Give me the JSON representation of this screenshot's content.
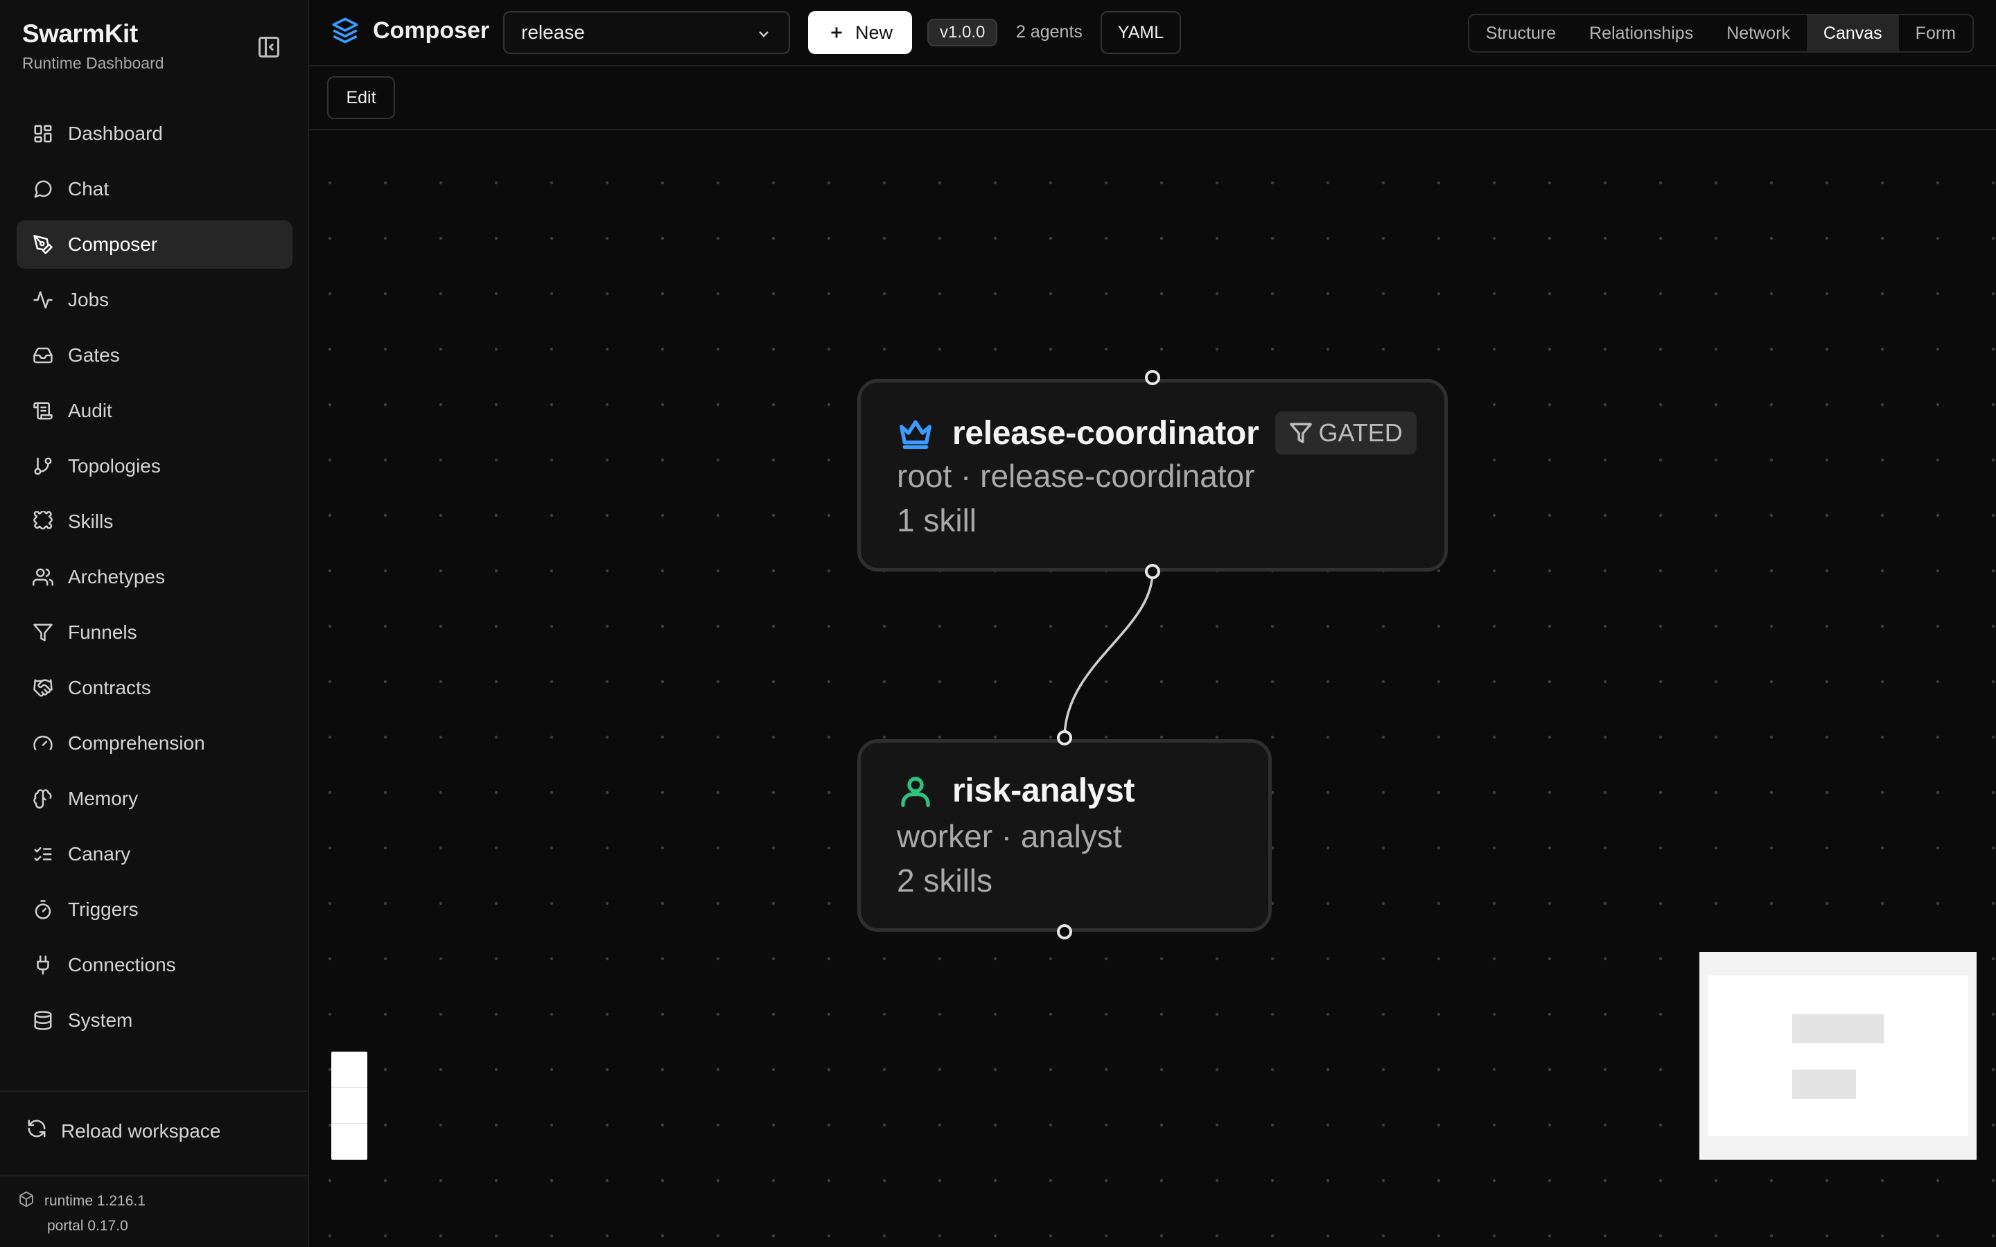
{
  "brand": {
    "title": "SwarmKit",
    "subtitle": "Runtime Dashboard"
  },
  "sidebar": {
    "items": [
      {
        "label": "Dashboard",
        "icon": "dashboard-icon"
      },
      {
        "label": "Chat",
        "icon": "chat-icon"
      },
      {
        "label": "Composer",
        "icon": "pen-tool-icon",
        "active": true
      },
      {
        "label": "Jobs",
        "icon": "activity-icon"
      },
      {
        "label": "Gates",
        "icon": "inbox-icon"
      },
      {
        "label": "Audit",
        "icon": "scroll-icon"
      },
      {
        "label": "Topologies",
        "icon": "git-branch-icon"
      },
      {
        "label": "Skills",
        "icon": "puzzle-icon"
      },
      {
        "label": "Archetypes",
        "icon": "users-icon"
      },
      {
        "label": "Funnels",
        "icon": "funnel-icon"
      },
      {
        "label": "Contracts",
        "icon": "handshake-icon"
      },
      {
        "label": "Comprehension",
        "icon": "gauge-icon"
      },
      {
        "label": "Memory",
        "icon": "brain-icon"
      },
      {
        "label": "Canary",
        "icon": "list-checks-icon"
      },
      {
        "label": "Triggers",
        "icon": "timer-icon"
      },
      {
        "label": "Connections",
        "icon": "plug-icon"
      },
      {
        "label": "System",
        "icon": "database-icon"
      }
    ],
    "reload_label": "Reload workspace",
    "runtime_version": "runtime 1.216.1",
    "portal_version": "portal 0.17.0"
  },
  "topbar": {
    "title": "Composer",
    "topology_select": "release",
    "new_label": "New",
    "version": "v1.0.0",
    "agents_count": "2 agents",
    "yaml_label": "YAML",
    "view_tabs": [
      {
        "label": "Structure"
      },
      {
        "label": "Relationships"
      },
      {
        "label": "Network"
      },
      {
        "label": "Canvas",
        "active": true
      },
      {
        "label": "Form"
      }
    ]
  },
  "toolbar": {
    "edit_label": "Edit"
  },
  "canvas": {
    "nodes": [
      {
        "title": "release-coordinator",
        "icon": "crown-icon",
        "icon_color": "#3b9cff",
        "badge": "GATED",
        "role_line": "root · release-coordinator",
        "skills_line": "1 skill"
      },
      {
        "title": "risk-analyst",
        "icon": "user-icon",
        "icon_color": "#2ec27e",
        "role_line": "worker · analyst",
        "skills_line": "2 skills"
      }
    ]
  },
  "colors": {
    "accent": "#3b9cff",
    "worker": "#2ec27e",
    "background": "#0b0b0b"
  }
}
